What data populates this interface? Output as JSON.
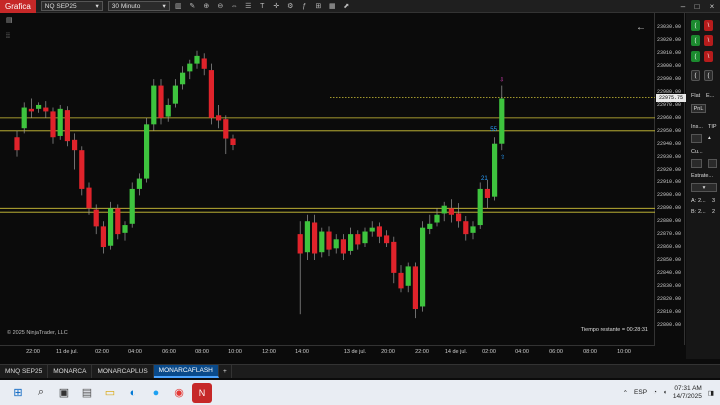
{
  "toolbar": {
    "app_label": "Grafica",
    "instrument": "NQ SEP25",
    "timeframe": "30 Minuto"
  },
  "chart": {
    "copyright": "© 2025 NinjaTrader, LLC",
    "time_remaining": "Tiempo restante = 00:28:31",
    "last_price": "22975.75",
    "marker_55": "55",
    "marker_21": "21",
    "colors": {
      "up": "#3ec43e",
      "down": "#e0232b",
      "level_line": "#d4c63a",
      "arrow_up": "#2aa0ff",
      "arrow_down": "#e040c0"
    }
  },
  "price_axis": {
    "labels": [
      "23030.00",
      "23020.00",
      "23010.00",
      "23000.00",
      "22990.00",
      "22980.00",
      "22970.00",
      "22960.00",
      "22950.00",
      "22940.00",
      "22930.00",
      "22920.00",
      "22910.00",
      "22900.00",
      "22890.00",
      "22880.00",
      "22870.00",
      "22860.00",
      "22850.00",
      "22840.00",
      "22830.00",
      "22820.00",
      "22810.00",
      "22800.00"
    ]
  },
  "time_axis": {
    "labels": [
      "22:00",
      "11 de jul.",
      "02:00",
      "04:00",
      "06:00",
      "08:00",
      "10:00",
      "12:00",
      "14:00",
      "13 de jul.",
      "20:00",
      "22:00",
      "14 de jul.",
      "02:00",
      "04:00",
      "06:00",
      "08:00",
      "10:00"
    ]
  },
  "chart_data": {
    "type": "candlestick",
    "ylim": [
      22795,
      23035
    ],
    "levels": [
      22975.75,
      22960,
      22950,
      22890,
      22887
    ],
    "candles": [
      {
        "o": 22945,
        "h": 22950,
        "c": 22935,
        "l": 22930
      },
      {
        "o": 22952,
        "h": 22972,
        "c": 22968,
        "l": 22948
      },
      {
        "o": 22967,
        "h": 22975,
        "c": 22965,
        "l": 22960
      },
      {
        "o": 22967,
        "h": 22972,
        "c": 22970,
        "l": 22964
      },
      {
        "o": 22968,
        "h": 22973,
        "c": 22965,
        "l": 22960
      },
      {
        "o": 22965,
        "h": 22968,
        "c": 22945,
        "l": 22940
      },
      {
        "o": 22946,
        "h": 22970,
        "c": 22967,
        "l": 22943
      },
      {
        "o": 22966,
        "h": 22969,
        "c": 22942,
        "l": 22938
      },
      {
        "o": 22943,
        "h": 22948,
        "c": 22935,
        "l": 22920
      },
      {
        "o": 22935,
        "h": 22938,
        "c": 22905,
        "l": 22900
      },
      {
        "o": 22906,
        "h": 22910,
        "c": 22890,
        "l": 22885
      },
      {
        "o": 22889,
        "h": 22893,
        "c": 22876,
        "l": 22870
      },
      {
        "o": 22876,
        "h": 22880,
        "c": 22860,
        "l": 22855
      },
      {
        "o": 22861,
        "h": 22895,
        "c": 22890,
        "l": 22858
      },
      {
        "o": 22890,
        "h": 22893,
        "c": 22870,
        "l": 22866
      },
      {
        "o": 22871,
        "h": 22880,
        "c": 22877,
        "l": 22865
      },
      {
        "o": 22878,
        "h": 22910,
        "c": 22905,
        "l": 22875
      },
      {
        "o": 22905,
        "h": 22917,
        "c": 22913,
        "l": 22900
      },
      {
        "o": 22913,
        "h": 22960,
        "c": 22955,
        "l": 22910
      },
      {
        "o": 22955,
        "h": 22990,
        "c": 22985,
        "l": 22950
      },
      {
        "o": 22985,
        "h": 22990,
        "c": 22960,
        "l": 22955
      },
      {
        "o": 22961,
        "h": 22975,
        "c": 22970,
        "l": 22957
      },
      {
        "o": 22971,
        "h": 22990,
        "c": 22985,
        "l": 22968
      },
      {
        "o": 22986,
        "h": 23000,
        "c": 22995,
        "l": 22982
      },
      {
        "o": 22996,
        "h": 23005,
        "c": 23002,
        "l": 22990
      },
      {
        "o": 23002,
        "h": 23012,
        "c": 23008,
        "l": 22998
      },
      {
        "o": 23006,
        "h": 23010,
        "c": 22998,
        "l": 22993
      },
      {
        "o": 22997,
        "h": 23002,
        "c": 22960,
        "l": 22955
      },
      {
        "o": 22962,
        "h": 22970,
        "c": 22958,
        "l": 22952
      },
      {
        "o": 22959,
        "h": 22962,
        "c": 22944,
        "l": 22932
      },
      {
        "o": 22944,
        "h": 22947,
        "c": 22939,
        "l": 22935
      },
      {
        "o": 22870,
        "h": 22880,
        "c": 22855,
        "l": 22808
      },
      {
        "o": 22856,
        "h": 22885,
        "c": 22880,
        "l": 22850
      },
      {
        "o": 22879,
        "h": 22885,
        "c": 22855,
        "l": 22850
      },
      {
        "o": 22856,
        "h": 22875,
        "c": 22872,
        "l": 22852
      },
      {
        "o": 22872,
        "h": 22876,
        "c": 22858,
        "l": 22853
      },
      {
        "o": 22859,
        "h": 22870,
        "c": 22866,
        "l": 22855
      },
      {
        "o": 22866,
        "h": 22870,
        "c": 22855,
        "l": 22850
      },
      {
        "o": 22857,
        "h": 22875,
        "c": 22870,
        "l": 22854
      },
      {
        "o": 22870,
        "h": 22873,
        "c": 22862,
        "l": 22858
      },
      {
        "o": 22863,
        "h": 22875,
        "c": 22872,
        "l": 22860
      },
      {
        "o": 22872,
        "h": 22880,
        "c": 22875,
        "l": 22868
      },
      {
        "o": 22876,
        "h": 22879,
        "c": 22868,
        "l": 22863
      },
      {
        "o": 22869,
        "h": 22873,
        "c": 22863,
        "l": 22860
      },
      {
        "o": 22864,
        "h": 22868,
        "c": 22840,
        "l": 22832
      },
      {
        "o": 22840,
        "h": 22846,
        "c": 22828,
        "l": 22825
      },
      {
        "o": 22830,
        "h": 22848,
        "c": 22845,
        "l": 22825
      },
      {
        "o": 22845,
        "h": 22848,
        "c": 22812,
        "l": 22805
      },
      {
        "o": 22814,
        "h": 22880,
        "c": 22875,
        "l": 22810
      },
      {
        "o": 22874,
        "h": 22885,
        "c": 22878,
        "l": 22870
      },
      {
        "o": 22879,
        "h": 22890,
        "c": 22885,
        "l": 22876
      },
      {
        "o": 22886,
        "h": 22895,
        "c": 22892,
        "l": 22880
      },
      {
        "o": 22890,
        "h": 22897,
        "c": 22885,
        "l": 22879
      },
      {
        "o": 22886,
        "h": 22894,
        "c": 22880,
        "l": 22875
      },
      {
        "o": 22880,
        "h": 22884,
        "c": 22870,
        "l": 22865
      },
      {
        "o": 22871,
        "h": 22880,
        "c": 22876,
        "l": 22866
      },
      {
        "o": 22877,
        "h": 22910,
        "c": 22905,
        "l": 22874
      },
      {
        "o": 22905,
        "h": 22912,
        "c": 22898,
        "l": 22890
      },
      {
        "o": 22899,
        "h": 22945,
        "c": 22940,
        "l": 22896
      },
      {
        "o": 22940,
        "h": 22985,
        "c": 22975,
        "l": 22935
      }
    ]
  },
  "panel": {
    "flat_label": "Flat",
    "e_label": "E...",
    "pnl_label": "PnL",
    "ins_label": "Ins...",
    "tip_label": "TIP",
    "cu_label": "Cu...",
    "estrategia_label": "Estrate...",
    "a_label": "A:",
    "a_value": "2...",
    "a_count": "3",
    "b_label": "B:",
    "b_value": "2...",
    "b_count": "2"
  },
  "tabs": [
    "MNQ SEP25",
    "MONARCA",
    "MONARCAPLUS",
    "MONARCAFLASH",
    "+"
  ],
  "active_tab": "MONARCAFLASH",
  "taskbar": {
    "lang": "ESP",
    "time": "07:31 AM",
    "date": "14/7/2025"
  }
}
